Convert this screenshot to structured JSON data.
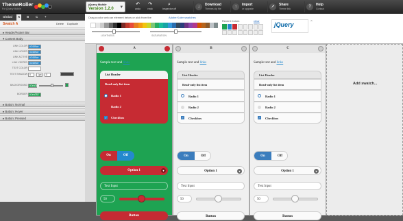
{
  "app": {
    "title": "ThemeRoller",
    "subtitle": "For jQuery Mobile"
  },
  "version": {
    "brand": "jQuery Mobile",
    "value": "Version 1.2.0"
  },
  "toolbar": {
    "undo": "undo",
    "redo": "redo",
    "inspector": "Inspector off",
    "download_title": "Download",
    "download_sub": "Themes zip file",
    "import_title": "Import",
    "import_sub": "or upgrade",
    "share_title": "Share",
    "share_sub": "Theme link",
    "help_title": "Help",
    "help_sub": "Contact"
  },
  "left_panel": {
    "tabs": [
      "Global",
      "A",
      "B",
      "C",
      "+"
    ],
    "swatch_title": "Swatch A",
    "delete": "Delete",
    "duplicate": "Duplicate",
    "sections": {
      "header": "Header/Footer Bar",
      "content": "Content Body",
      "button_normal": "Button: Normal",
      "button_hover": "Button: Hover",
      "button_pressed": "Button: Pressed"
    },
    "fields": [
      {
        "label": "LINK COLOR",
        "value": "#2489ce"
      },
      {
        "label": "LINK HOVER",
        "value": "#2489ce"
      },
      {
        "label": "LINK ACTIVE",
        "value": "#2489ce"
      },
      {
        "label": "LINK VISITED",
        "value": "#2489ce"
      },
      {
        "label": "TEXT COLOR",
        "value": ""
      },
      {
        "label": "TEXT SHADOW",
        "value": "0"
      },
      {
        "label": "BACKGROUND",
        "value": "#1ea352"
      },
      {
        "label": "BORDER",
        "value": "#1ea352"
      }
    ],
    "shadow_extra": [
      "1px",
      "0"
    ]
  },
  "colorbar": {
    "hint": "Drag a color onto an element below or pick from the",
    "kuler": "Adobe Kuler swatches",
    "lightness": "LIGHTNESS",
    "saturation": "SATURATION",
    "recent": "Recent Colors",
    "clear": "clear",
    "jquery_logo": "jQuery"
  },
  "swatches": [
    {
      "letter": "A",
      "header_bg": "#e3e3e3",
      "body_bg": "#1ea352",
      "list_bg": "#c62b33",
      "accent": "#c62b33",
      "text": "#ffffff",
      "sample_text": "Sample text and",
      "link": "links"
    },
    {
      "letter": "B",
      "header_bg": "#e3e3e3",
      "body_bg": "#f0f0f0",
      "list_bg": "#f7f7f7",
      "accent": "#3b7dbd",
      "text": "#222222",
      "sample_text": "Sample text and",
      "link": "links"
    },
    {
      "letter": "C",
      "header_bg": "#e3e3e3",
      "body_bg": "#f0f0f0",
      "list_bg": "#f7f7f7",
      "accent": "#3b7dbd",
      "text": "#222222",
      "sample_text": "Sample text and",
      "link": "links"
    }
  ],
  "preview": {
    "list_header": "List Header",
    "readonly": "Read-only list item",
    "radio1": "Radio 1",
    "radio2": "Radio 2",
    "checkbox": "Checkbox",
    "on": "On",
    "off": "Off",
    "option": "Option 1",
    "text_input": "Text Input",
    "slider_value": "50",
    "button": "Button"
  },
  "add_swatch": "Add swatch..."
}
